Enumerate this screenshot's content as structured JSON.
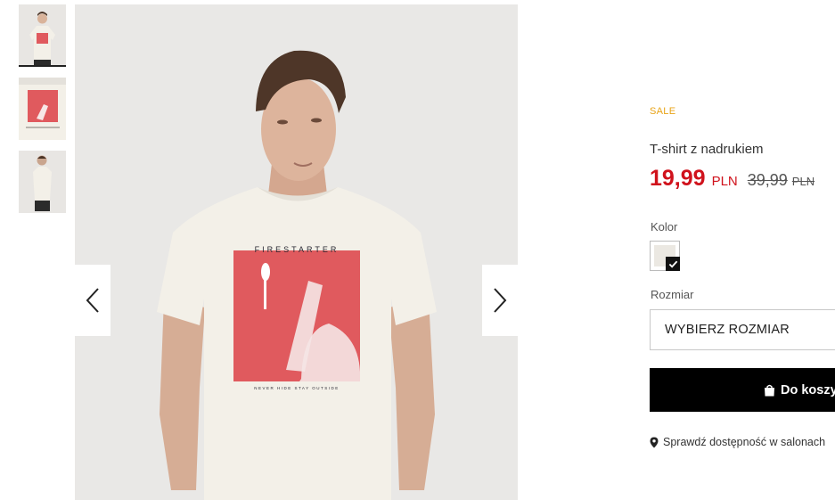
{
  "gallery": {
    "thumbnails": [
      {
        "name": "front-view",
        "active": true
      },
      {
        "name": "print-detail",
        "active": false
      },
      {
        "name": "side-view",
        "active": false
      }
    ],
    "print_heading": "FIRESTARTER",
    "print_tagline": "NEVER HIDE STAY OUTSIDE",
    "prev_icon": "chevron-left-icon",
    "next_icon": "chevron-right-icon"
  },
  "product": {
    "badge": "SALE",
    "title": "T-shirt z nadrukiem",
    "price_current": "19,99",
    "price_current_currency": "PLN",
    "price_old": "39,99",
    "price_old_currency": "PLN",
    "color_label": "Kolor",
    "color_selected": "#ebe8e2",
    "size_label": "Rozmiar",
    "size_placeholder": "WYBIERZ ROZMIAR",
    "add_to_cart_label": "Do koszy",
    "store_availability": "Sprawdź dostępność w salonach"
  },
  "colors": {
    "sale": "#e8a316",
    "price": "#d0121c",
    "button": "#000000",
    "print_red": "#e05a5e"
  }
}
